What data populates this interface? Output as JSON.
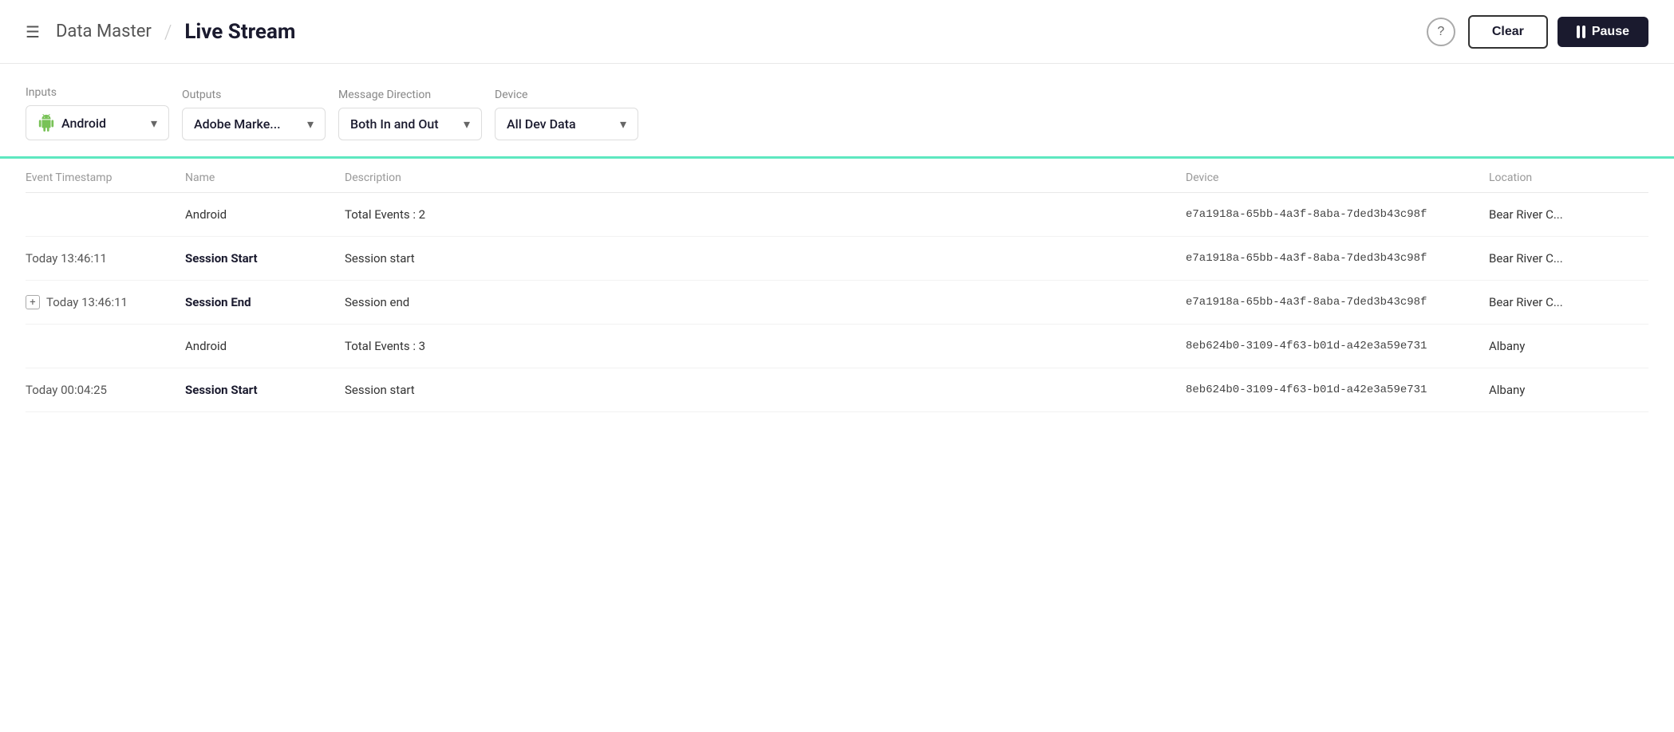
{
  "header": {
    "app_title": "Data Master",
    "divider": "/",
    "page_title": "Live Stream",
    "help_icon": "?",
    "clear_label": "Clear",
    "pause_label": "Pause"
  },
  "filters": {
    "inputs_label": "Inputs",
    "inputs_value": "Android",
    "outputs_label": "Outputs",
    "outputs_value": "Adobe Marke...",
    "direction_label": "Message Direction",
    "direction_value": "Both In and Out",
    "device_label": "Device",
    "device_value": "All Dev Data"
  },
  "table": {
    "columns": [
      "Event Timestamp",
      "Name",
      "Description",
      "Device",
      "Location"
    ],
    "rows": [
      {
        "timestamp": "",
        "name": "Android",
        "name_bold": false,
        "description": "Total Events : 2",
        "device": "e7a1918a-65bb-4a3f-8aba-7ded3b43c98f",
        "location": "Bear River C...",
        "has_expand": false
      },
      {
        "timestamp": "Today 13:46:11",
        "name": "Session Start",
        "name_bold": true,
        "description": "Session start",
        "device": "e7a1918a-65bb-4a3f-8aba-7ded3b43c98f",
        "location": "Bear River C...",
        "has_expand": false
      },
      {
        "timestamp": "Today 13:46:11",
        "name": "Session End",
        "name_bold": true,
        "description": "Session end",
        "device": "e7a1918a-65bb-4a3f-8aba-7ded3b43c98f",
        "location": "Bear River C...",
        "has_expand": true
      },
      {
        "timestamp": "",
        "name": "Android",
        "name_bold": false,
        "description": "Total Events : 3",
        "device": "8eb624b0-3109-4f63-b01d-a42e3a59e731",
        "location": "Albany",
        "has_expand": false
      },
      {
        "timestamp": "Today 00:04:25",
        "name": "Session Start",
        "name_bold": true,
        "description": "Session start",
        "device": "8eb624b0-3109-4f63-b01d-a42e3a59e731",
        "location": "Albany",
        "has_expand": false
      }
    ]
  }
}
